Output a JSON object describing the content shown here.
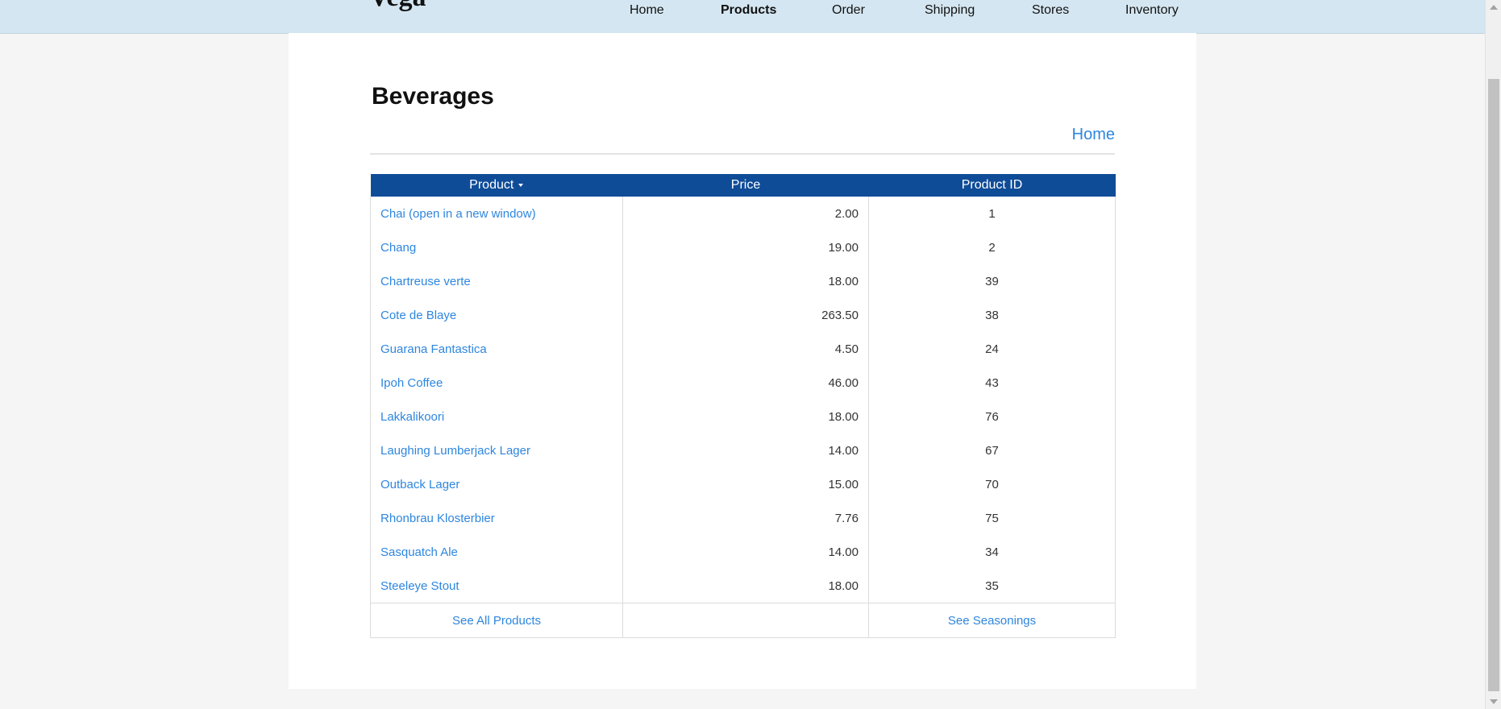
{
  "header": {
    "logo_text": "Vega",
    "nav": [
      {
        "label": "Home"
      },
      {
        "label": "Products"
      },
      {
        "label": "Order"
      },
      {
        "label": "Shipping"
      },
      {
        "label": "Stores"
      },
      {
        "label": "Inventory"
      }
    ]
  },
  "page": {
    "title": "Beverages",
    "home_link": "Home"
  },
  "table": {
    "headers": {
      "product": "Product",
      "price": "Price",
      "product_id": "Product ID"
    },
    "rows": [
      {
        "name": "Chai  (open in a new window)",
        "price": "2.00",
        "id": "1"
      },
      {
        "name": "Chang",
        "price": "19.00",
        "id": "2"
      },
      {
        "name": "Chartreuse verte",
        "price": "18.00",
        "id": "39"
      },
      {
        "name": "Cote de Blaye",
        "price": "263.50",
        "id": "38"
      },
      {
        "name": "Guarana Fantastica",
        "price": "4.50",
        "id": "24"
      },
      {
        "name": "Ipoh Coffee",
        "price": "46.00",
        "id": "43"
      },
      {
        "name": "Lakkalikoori",
        "price": "18.00",
        "id": "76"
      },
      {
        "name": "Laughing Lumberjack Lager",
        "price": "14.00",
        "id": "67"
      },
      {
        "name": "Outback Lager",
        "price": "15.00",
        "id": "70"
      },
      {
        "name": "Rhonbrau Klosterbier",
        "price": "7.76",
        "id": "75"
      },
      {
        "name": "Sasquatch Ale",
        "price": "14.00",
        "id": "34"
      },
      {
        "name": "Steeleye Stout",
        "price": "18.00",
        "id": "35"
      }
    ],
    "footer": {
      "see_all": "See All Products",
      "see_next": "See Seasonings"
    }
  },
  "colors": {
    "header_bg": "#d4e6f1",
    "table_header_bg": "#0f4c98",
    "link": "#2e86de"
  }
}
